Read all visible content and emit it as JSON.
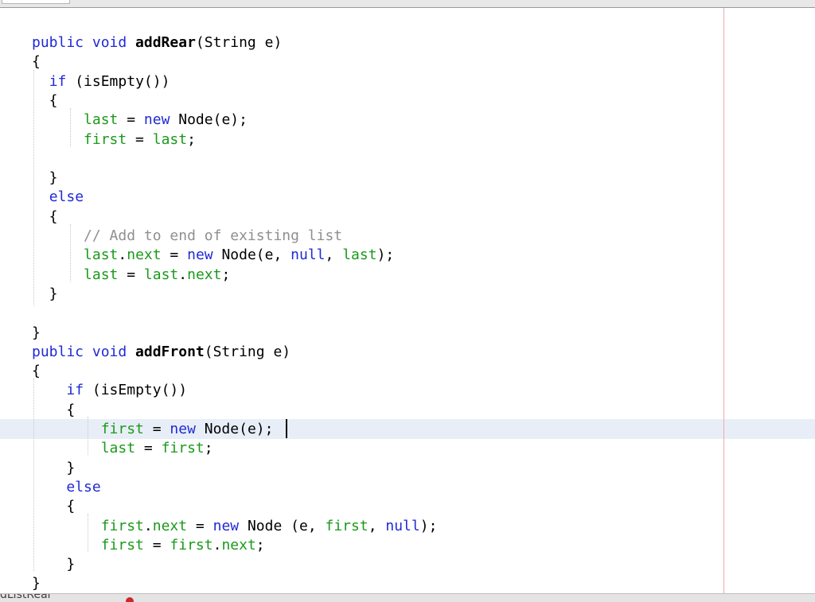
{
  "editor": {
    "cursor_line_index": 20,
    "lines": [
      [
        {
          "t": "public void ",
          "c": "kw"
        },
        {
          "t": "addRear",
          "c": "fn"
        },
        {
          "t": "(String e)",
          "c": "p"
        }
      ],
      [
        {
          "t": "{",
          "c": "p"
        }
      ],
      [
        {
          "t": "  ",
          "c": "p"
        },
        {
          "t": "if",
          "c": "kw"
        },
        {
          "t": " (isEmpty())",
          "c": "p"
        }
      ],
      [
        {
          "t": "  {",
          "c": "p"
        }
      ],
      [
        {
          "t": "      ",
          "c": "p"
        },
        {
          "t": "last",
          "c": "fld"
        },
        {
          "t": " = ",
          "c": "p"
        },
        {
          "t": "new",
          "c": "kw"
        },
        {
          "t": " Node(e);",
          "c": "p"
        }
      ],
      [
        {
          "t": "      ",
          "c": "p"
        },
        {
          "t": "first",
          "c": "fld"
        },
        {
          "t": " = ",
          "c": "p"
        },
        {
          "t": "last",
          "c": "fld"
        },
        {
          "t": ";",
          "c": "p"
        }
      ],
      [],
      [
        {
          "t": "  }",
          "c": "p"
        }
      ],
      [
        {
          "t": "  ",
          "c": "p"
        },
        {
          "t": "else",
          "c": "kw"
        }
      ],
      [
        {
          "t": "  {",
          "c": "p"
        }
      ],
      [
        {
          "t": "      ",
          "c": "p"
        },
        {
          "t": "// Add to end of existing list",
          "c": "cm"
        }
      ],
      [
        {
          "t": "      ",
          "c": "p"
        },
        {
          "t": "last",
          "c": "fld"
        },
        {
          "t": ".",
          "c": "p"
        },
        {
          "t": "next",
          "c": "fld"
        },
        {
          "t": " = ",
          "c": "p"
        },
        {
          "t": "new",
          "c": "kw"
        },
        {
          "t": " Node(e, ",
          "c": "p"
        },
        {
          "t": "null",
          "c": "kw"
        },
        {
          "t": ", ",
          "c": "p"
        },
        {
          "t": "last",
          "c": "fld"
        },
        {
          "t": ");",
          "c": "p"
        }
      ],
      [
        {
          "t": "      ",
          "c": "p"
        },
        {
          "t": "last",
          "c": "fld"
        },
        {
          "t": " = ",
          "c": "p"
        },
        {
          "t": "last",
          "c": "fld"
        },
        {
          "t": ".",
          "c": "p"
        },
        {
          "t": "next",
          "c": "fld"
        },
        {
          "t": ";",
          "c": "p"
        }
      ],
      [
        {
          "t": "  }",
          "c": "p"
        }
      ],
      [],
      [
        {
          "t": "}",
          "c": "p"
        }
      ],
      [
        {
          "t": "public void ",
          "c": "kw"
        },
        {
          "t": "addFront",
          "c": "fn"
        },
        {
          "t": "(String e)",
          "c": "p"
        }
      ],
      [
        {
          "t": "{",
          "c": "p"
        }
      ],
      [
        {
          "t": "    ",
          "c": "p"
        },
        {
          "t": "if",
          "c": "kw"
        },
        {
          "t": " (isEmpty())",
          "c": "p"
        }
      ],
      [
        {
          "t": "    {",
          "c": "p"
        }
      ],
      [
        {
          "t": "        ",
          "c": "p"
        },
        {
          "t": "first",
          "c": "fld"
        },
        {
          "t": " = ",
          "c": "p"
        },
        {
          "t": "new",
          "c": "kw"
        },
        {
          "t": " Node(e);",
          "c": "p"
        }
      ],
      [
        {
          "t": "        ",
          "c": "p"
        },
        {
          "t": "last",
          "c": "fld"
        },
        {
          "t": " = ",
          "c": "p"
        },
        {
          "t": "first",
          "c": "fld"
        },
        {
          "t": ";",
          "c": "p"
        }
      ],
      [
        {
          "t": "    }",
          "c": "p"
        }
      ],
      [
        {
          "t": "    ",
          "c": "p"
        },
        {
          "t": "else",
          "c": "kw"
        }
      ],
      [
        {
          "t": "    {",
          "c": "p"
        }
      ],
      [
        {
          "t": "        ",
          "c": "p"
        },
        {
          "t": "first",
          "c": "fld"
        },
        {
          "t": ".",
          "c": "p"
        },
        {
          "t": "next",
          "c": "fld"
        },
        {
          "t": " = ",
          "c": "p"
        },
        {
          "t": "new",
          "c": "kw"
        },
        {
          "t": " Node (e, ",
          "c": "p"
        },
        {
          "t": "first",
          "c": "fld"
        },
        {
          "t": ", ",
          "c": "p"
        },
        {
          "t": "null",
          "c": "kw"
        },
        {
          "t": ");",
          "c": "p"
        }
      ],
      [
        {
          "t": "        ",
          "c": "p"
        },
        {
          "t": "first",
          "c": "fld"
        },
        {
          "t": " = ",
          "c": "p"
        },
        {
          "t": "first",
          "c": "fld"
        },
        {
          "t": ".",
          "c": "p"
        },
        {
          "t": "next",
          "c": "fld"
        },
        {
          "t": ";",
          "c": "p"
        }
      ],
      [
        {
          "t": "    }",
          "c": "p"
        }
      ],
      [
        {
          "t": "}",
          "c": "p"
        }
      ]
    ]
  },
  "colors": {
    "keyword": "#1f2ad6",
    "field": "#1a9a1a",
    "comment": "#8f8f8f",
    "margin_line": "#f2a8a8",
    "current_line_highlight": "#e8eef7"
  },
  "status_bar": {
    "text": "dListRear",
    "error_icon": "error-dot-icon"
  }
}
